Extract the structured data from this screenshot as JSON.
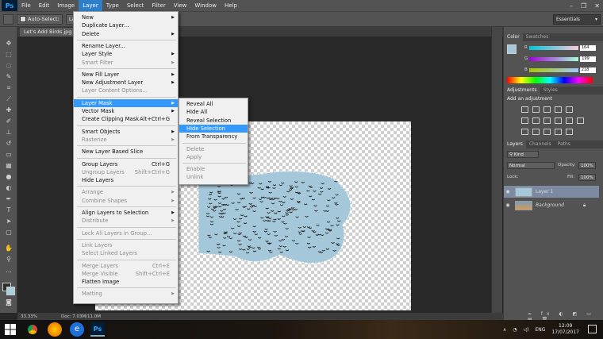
{
  "app": {
    "logo": "Ps"
  },
  "menubar": {
    "items": [
      "File",
      "Edit",
      "Image",
      "Layer",
      "Type",
      "Select",
      "Filter",
      "View",
      "Window",
      "Help"
    ],
    "active": "Layer",
    "window_controls": [
      "–",
      "❐",
      "✕"
    ]
  },
  "options_bar": {
    "auto_select_label": "Auto-Select:",
    "auto_select_value": "Layer",
    "workspace": "Essentials"
  },
  "document": {
    "tab_title": "Let's Add Birds.jpg @",
    "zoom": "33.33%",
    "doc_size": "Doc: 7.03M/11.0M"
  },
  "layer_menu": {
    "items": [
      {
        "label": "New",
        "shortcut": "",
        "submenu": true,
        "disabled": false
      },
      {
        "label": "Duplicate Layer...",
        "shortcut": "",
        "submenu": false,
        "disabled": false
      },
      {
        "label": "Delete",
        "shortcut": "",
        "submenu": true,
        "disabled": false
      },
      {
        "label": "Rename Layer...",
        "shortcut": "",
        "submenu": false,
        "disabled": false
      },
      {
        "label": "Layer Style",
        "shortcut": "",
        "submenu": true,
        "disabled": false
      },
      {
        "label": "Smart Filter",
        "shortcut": "",
        "submenu": true,
        "disabled": true
      },
      {
        "label": "New Fill Layer",
        "shortcut": "",
        "submenu": true,
        "disabled": false
      },
      {
        "label": "New Adjustment Layer",
        "shortcut": "",
        "submenu": true,
        "disabled": false
      },
      {
        "label": "Layer Content Options...",
        "shortcut": "",
        "submenu": false,
        "disabled": true
      },
      {
        "label": "Layer Mask",
        "shortcut": "",
        "submenu": true,
        "disabled": false
      },
      {
        "label": "Vector Mask",
        "shortcut": "",
        "submenu": true,
        "disabled": false
      },
      {
        "label": "Create Clipping Mask",
        "shortcut": "Alt+Ctrl+G",
        "submenu": false,
        "disabled": false
      },
      {
        "label": "Smart Objects",
        "shortcut": "",
        "submenu": true,
        "disabled": false
      },
      {
        "label": "Rasterize",
        "shortcut": "",
        "submenu": true,
        "disabled": true
      },
      {
        "label": "New Layer Based Slice",
        "shortcut": "",
        "submenu": false,
        "disabled": false
      },
      {
        "label": "Group Layers",
        "shortcut": "Ctrl+G",
        "submenu": false,
        "disabled": false
      },
      {
        "label": "Ungroup Layers",
        "shortcut": "Shift+Ctrl+G",
        "submenu": false,
        "disabled": true
      },
      {
        "label": "Hide Layers",
        "shortcut": "",
        "submenu": false,
        "disabled": false
      },
      {
        "label": "Arrange",
        "shortcut": "",
        "submenu": true,
        "disabled": true
      },
      {
        "label": "Combine Shapes",
        "shortcut": "",
        "submenu": true,
        "disabled": true
      },
      {
        "label": "Align Layers to Selection",
        "shortcut": "",
        "submenu": true,
        "disabled": false
      },
      {
        "label": "Distribute",
        "shortcut": "",
        "submenu": true,
        "disabled": true
      },
      {
        "label": "Lock All Layers in Group...",
        "shortcut": "",
        "submenu": false,
        "disabled": true
      },
      {
        "label": "Link Layers",
        "shortcut": "",
        "submenu": false,
        "disabled": true
      },
      {
        "label": "Select Linked Layers",
        "shortcut": "",
        "submenu": false,
        "disabled": true
      },
      {
        "label": "Merge Layers",
        "shortcut": "Ctrl+E",
        "submenu": false,
        "disabled": true
      },
      {
        "label": "Merge Visible",
        "shortcut": "Shift+Ctrl+E",
        "submenu": false,
        "disabled": true
      },
      {
        "label": "Flatten Image",
        "shortcut": "",
        "submenu": false,
        "disabled": false
      },
      {
        "label": "Matting",
        "shortcut": "",
        "submenu": true,
        "disabled": true
      }
    ],
    "highlighted": "Layer Mask"
  },
  "mask_submenu": {
    "items": [
      {
        "label": "Reveal All",
        "disabled": false
      },
      {
        "label": "Hide All",
        "disabled": false
      },
      {
        "label": "Reveal Selection",
        "disabled": false
      },
      {
        "label": "Hide Selection",
        "disabled": false
      },
      {
        "label": "From Transparency",
        "disabled": false
      },
      {
        "label": "Delete",
        "disabled": true
      },
      {
        "label": "Apply",
        "disabled": true
      },
      {
        "label": "Enable",
        "disabled": true
      },
      {
        "label": "Unlink",
        "disabled": true
      }
    ],
    "highlighted": "Hide Selection"
  },
  "color_panel": {
    "tabs": [
      "Color",
      "Swatches"
    ],
    "channels": [
      {
        "label": "R",
        "value": "164",
        "fill": 0.64
      },
      {
        "label": "G",
        "value": "199",
        "fill": 0.78
      },
      {
        "label": "B",
        "value": "218",
        "fill": 0.85
      }
    ],
    "fg_color": "#a4c7da"
  },
  "adjustments_panel": {
    "tabs": [
      "Adjustments",
      "Styles"
    ],
    "title": "Add an adjustment"
  },
  "layers_panel": {
    "tabs": [
      "Layers",
      "Channels",
      "Paths"
    ],
    "kind_label": "Kind",
    "blend_mode": "Normal",
    "opacity_label": "Opacity:",
    "opacity_value": "100%",
    "lock_label": "Lock:",
    "fill_label": "Fill:",
    "fill_value": "100%",
    "layers": [
      {
        "name": "Layer 1",
        "selected": true
      },
      {
        "name": "Background",
        "selected": false
      }
    ]
  },
  "taskbar": {
    "language": "ENG",
    "time": "12:09",
    "date": "17/07/2017",
    "apps": [
      "chrome-icon",
      "firefox-icon",
      "edge-icon",
      "photoshop-icon"
    ]
  },
  "colors": {
    "accent": "#3399ff",
    "selection_blue": "#a4c7da",
    "menu_bg": "#f0f0f0",
    "ui_gray": "#535353"
  }
}
